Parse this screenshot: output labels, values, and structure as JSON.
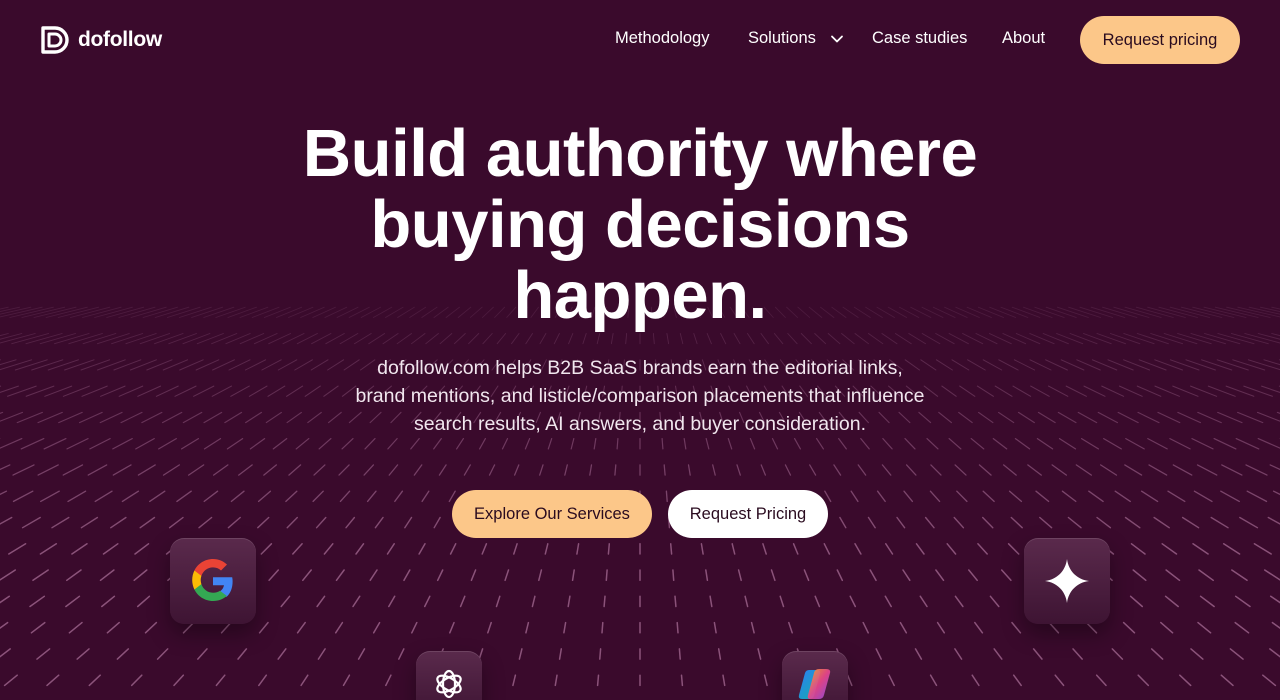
{
  "brand": {
    "name": "dofollow",
    "logo_icon": "dofollow-logo-icon"
  },
  "nav": {
    "items": [
      {
        "label": "Methodology"
      },
      {
        "label": "Solutions",
        "icon": "chevron-down-icon"
      },
      {
        "label": "Case studies"
      },
      {
        "label": "About"
      }
    ],
    "cta_label": "Request pricing"
  },
  "hero": {
    "title_lines": [
      "Build authority where",
      "buying decisions",
      "happen."
    ],
    "subtitle": "dofollow.com helps B2B SaaS brands earn the editorial links, brand mentions, and listicle/comparison placements that influence search results, AI answers, and buyer consideration.",
    "primary_cta": "Explore Our Services",
    "secondary_cta": "Request Pricing"
  },
  "floating_tiles": [
    {
      "icon": "google-icon"
    },
    {
      "icon": "gemini-sparkle-icon"
    },
    {
      "icon": "openai-icon"
    },
    {
      "icon": "copilot-icon"
    }
  ],
  "colors": {
    "background": "#3a0a2c",
    "accent": "#fcc789",
    "grid_dash": "#c98bb6",
    "text": "#ffffff"
  }
}
